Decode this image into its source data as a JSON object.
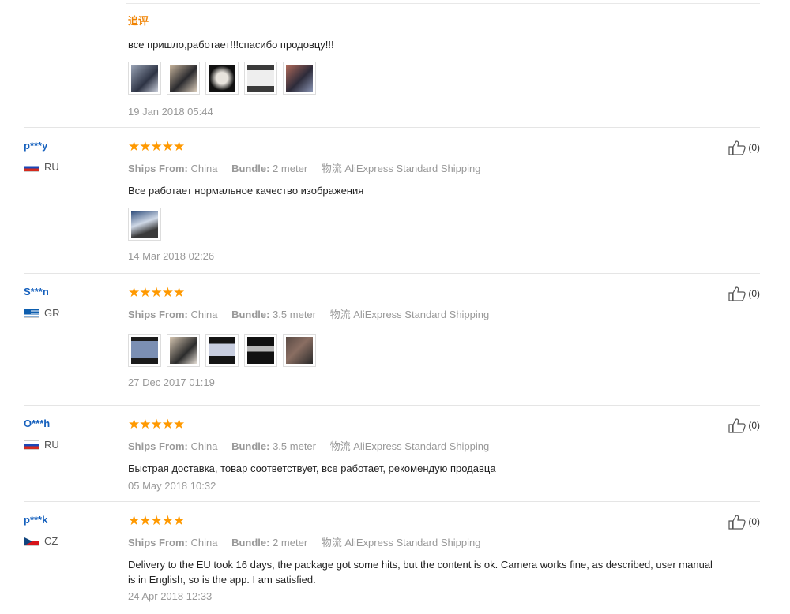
{
  "first": {
    "tag": "追评",
    "text": "все пришло,работает!!!спасибо продовцу!!!",
    "date": "19 Jan 2018 05:44"
  },
  "labels": {
    "ships_from": "Ships From:",
    "bundle": "Bundle:",
    "shipping_icon": "物流"
  },
  "reviews": [
    {
      "user": "p***y",
      "country": "RU",
      "stars": "★★★★★",
      "ships_from": "China",
      "bundle": "2 meter",
      "shipping": "AliExpress Standard Shipping",
      "text": "Все работает нормальное качество изображения",
      "date": "14 Mar 2018 02:26",
      "likes": "(0)"
    },
    {
      "user": "S***n",
      "country": "GR",
      "stars": "★★★★★",
      "ships_from": "China",
      "bundle": "3.5 meter",
      "shipping": "AliExpress Standard Shipping",
      "text": "",
      "date": "27 Dec 2017 01:19",
      "likes": "(0)"
    },
    {
      "user": "O***h",
      "country": "RU",
      "stars": "★★★★★",
      "ships_from": "China",
      "bundle": "3.5 meter",
      "shipping": "AliExpress Standard Shipping",
      "text": "Быстрая доставка, товар соответствует, все работает, рекомендую продавца",
      "date": "05 May 2018 10:32",
      "likes": "(0)"
    },
    {
      "user": "p***k",
      "country": "CZ",
      "stars": "★★★★★",
      "ships_from": "China",
      "bundle": "2 meter",
      "shipping": "AliExpress Standard Shipping",
      "text": "Delivery to the EU took 16 days, the package got some hits, but the content is ok. Camera works fine, as described, user manual is in English, so is the app. I am satisfied.",
      "date": "24 Apr 2018 12:33",
      "likes": "(0)"
    }
  ]
}
